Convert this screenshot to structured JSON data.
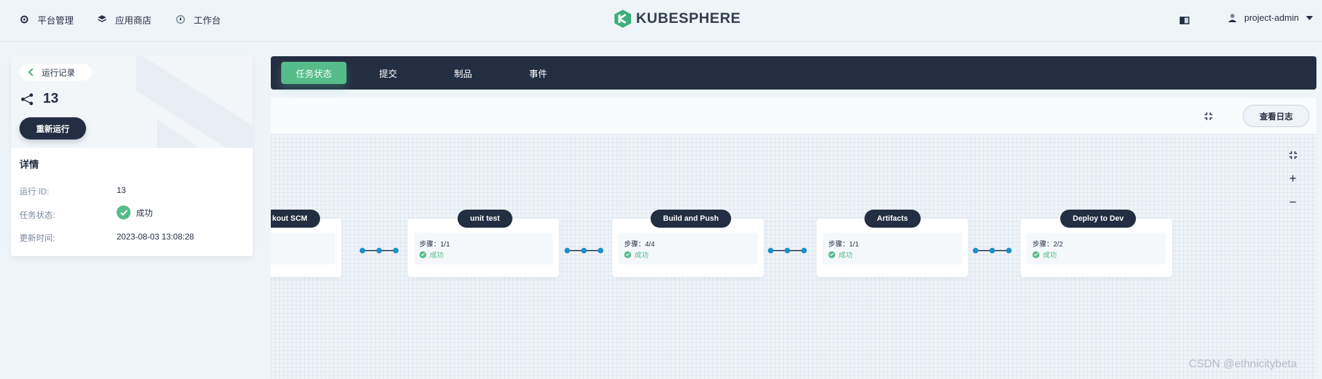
{
  "nav": {
    "items": [
      {
        "label": "平台管理",
        "icon": "gear-icon"
      },
      {
        "label": "应用商店",
        "icon": "cube-icon"
      },
      {
        "label": "工作台",
        "icon": "compass-icon"
      }
    ],
    "brand": "KUBESPHERE",
    "user": "project-admin"
  },
  "run": {
    "back_label": "运行记录",
    "number": "13",
    "rerun_label": "重新运行",
    "details_title": "详情",
    "fields": [
      {
        "label": "运行 ID:",
        "value": "13"
      },
      {
        "label": "任务状态:",
        "value": "成功"
      },
      {
        "label": "更新时间:",
        "value": "2023-08-03 13:08:28"
      }
    ]
  },
  "tabs": [
    {
      "label": "任务状态",
      "active": true
    },
    {
      "label": "提交",
      "active": false
    },
    {
      "label": "制品",
      "active": false
    },
    {
      "label": "事件",
      "active": false
    }
  ],
  "toolbar": {
    "log_button": "查看日志"
  },
  "pipeline": {
    "stages": [
      {
        "name": "kout SCM",
        "steps": "",
        "status": ""
      },
      {
        "name": "unit test",
        "steps": "步骤：1/1",
        "status": "成功"
      },
      {
        "name": "Build and Push",
        "steps": "步骤：4/4",
        "status": "成功"
      },
      {
        "name": "Artifacts",
        "steps": "步骤：1/1",
        "status": "成功"
      },
      {
        "name": "Deploy to Dev",
        "steps": "步骤：2/2",
        "status": "成功"
      }
    ],
    "zoom": {
      "plus": "+",
      "minus": "−"
    }
  },
  "colors": {
    "accent": "#55bc8a",
    "dark": "#242e42",
    "link": "#1c8fc9"
  },
  "watermark": "CSDN @ethnicitybeta"
}
